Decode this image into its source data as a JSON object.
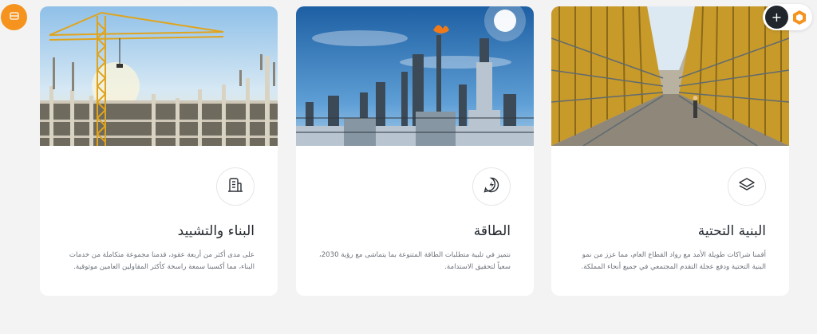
{
  "floating": {
    "left_button_icon": "stack-tray-icon",
    "plus_icon": "plus-icon",
    "plus_glyph": "+",
    "badge_icon": "hexagon-badge-icon"
  },
  "colors": {
    "accent_orange": "#f5931e",
    "dark": "#20262c",
    "page_bg": "#f3f3f4",
    "card_bg": "#ffffff"
  },
  "cards": [
    {
      "title": "البنية التحتية",
      "description": "أقمنا شراكات طويلة الأمد مع رواد القطاع العام، مما عزز من نمو البنية التحتية ودفع عجلة التقدم المجتمعي في جميع أنحاء المملكة.",
      "icon": "layers-icon",
      "image": "infrastructure-scaffolding-photo"
    },
    {
      "title": "الطاقة",
      "description": "نتميز في تلبية متطلبات الطاقة المتنوعة بما يتماشى مع رؤية 2030، سعياً لتحقيق الاستدامة.",
      "icon": "energy-bolt-icon",
      "image": "energy-refinery-photo"
    },
    {
      "title": "البناء والتشييد",
      "description": "على مدى أكثر من أربعة عقود، قدمنا مجموعة متكاملة من خدمات البناء، مما أكسبنا سمعة راسخة كأكثر المقاولين العامين موثوقية.",
      "icon": "building-icon",
      "image": "construction-crane-photo"
    }
  ]
}
